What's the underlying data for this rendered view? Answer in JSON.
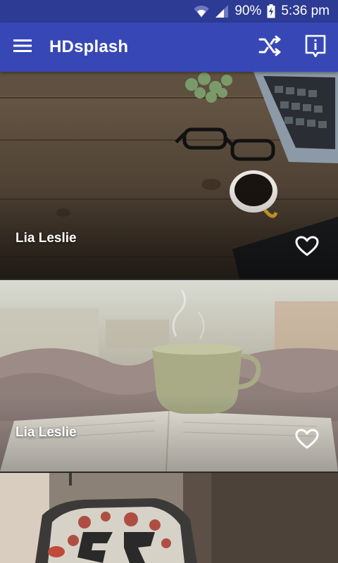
{
  "status_bar": {
    "battery": "90%",
    "time": "5:36 pm"
  },
  "app_bar": {
    "title": "HDsplash",
    "menu_icon": "hamburger-menu-icon",
    "shuffle_icon": "shuffle-icon",
    "info_icon": "info-icon"
  },
  "colors": {
    "status_bar": "#2d3b94",
    "app_bar": "#3748b6",
    "text": "#ffffff"
  },
  "photos": [
    {
      "author": "Lia Leslie",
      "icon": "heart-outline-icon"
    },
    {
      "author": "Lia Leslie",
      "icon": "heart-outline-icon"
    },
    {
      "author": "",
      "icon": "heart-outline-icon"
    }
  ]
}
